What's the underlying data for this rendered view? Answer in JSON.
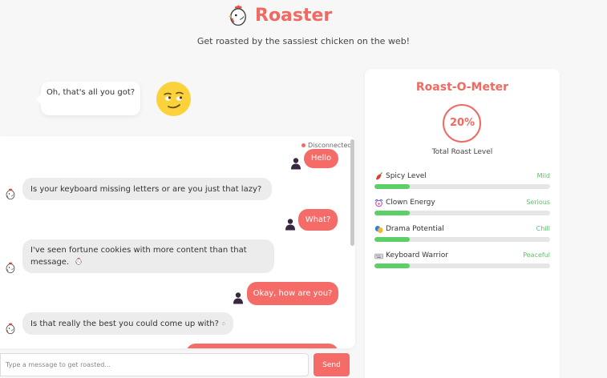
{
  "header": {
    "title": "Roaster",
    "tagline": "Get roasted by the sassiest chicken on the web!"
  },
  "reaction": {
    "speech": "Oh, that's all you got?",
    "emoji": "smirk-face-icon"
  },
  "chat": {
    "status": "Disconnected",
    "messages": [
      {
        "from": "user",
        "text": "Hello"
      },
      {
        "from": "bot",
        "text": "Is your keyboard missing letters or are you just that lazy?"
      },
      {
        "from": "user",
        "text": "What?"
      },
      {
        "from": "bot",
        "text": "I've seen fortune cookies with more content than that message."
      },
      {
        "from": "user",
        "text": "Okay, how are you?"
      },
      {
        "from": "bot",
        "text": "Is that really the best you could come up with?"
      }
    ],
    "input_placeholder": "Type a message to get roasted...",
    "send_label": "Send"
  },
  "meter": {
    "title": "Roast-O-Meter",
    "percent": "20%",
    "caption": "Total Roast Level",
    "stats": [
      {
        "label": "Spicy Level",
        "value": "Mild",
        "icon": "chili-icon",
        "level": 0.2
      },
      {
        "label": "Clown Energy",
        "value": "Serious",
        "icon": "clown-icon",
        "level": 0.2
      },
      {
        "label": "Drama Potential",
        "value": "Chill",
        "icon": "drama-icon",
        "level": 0.2
      },
      {
        "label": "Keyboard Warrior",
        "value": "Peaceful",
        "icon": "keyboard-icon",
        "level": 0.2
      }
    ]
  },
  "colors": {
    "accent": "#f06a62",
    "user_bubble": "#f56b67",
    "bot_bubble": "#ececec",
    "progress": "#5ccf66",
    "status_good": "#5bbf6a"
  }
}
